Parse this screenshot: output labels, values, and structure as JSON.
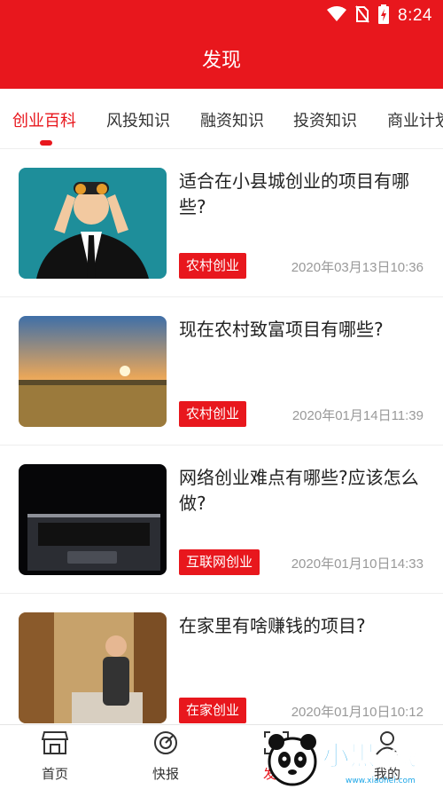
{
  "status": {
    "time": "8:24",
    "icons": [
      "wifi-icon",
      "no-sim-icon",
      "battery-charging-icon"
    ]
  },
  "header": {
    "title": "发现"
  },
  "tabs": [
    {
      "label": "创业百科",
      "active": true
    },
    {
      "label": "风投知识",
      "active": false
    },
    {
      "label": "融资知识",
      "active": false
    },
    {
      "label": "投资知识",
      "active": false
    },
    {
      "label": "商业计划",
      "active": false
    }
  ],
  "articles": [
    {
      "title": "适合在小县城创业的项目有哪些?",
      "tag": "农村创业",
      "date": "2020年03月13日10:36",
      "thumb": "man-with-binoculars"
    },
    {
      "title": "现在农村致富项目有哪些?",
      "tag": "农村创业",
      "date": "2020年01月14日11:39",
      "thumb": "sunset-field"
    },
    {
      "title": "网络创业难点有哪些?应该怎么做?",
      "tag": "互联网创业",
      "date": "2020年01月10日14:33",
      "thumb": "laptop-keyboard"
    },
    {
      "title": "在家里有啥赚钱的项目?",
      "tag": "在家创业",
      "date": "2020年01月10日10:12",
      "thumb": "bookstore-man"
    }
  ],
  "bottom_nav": [
    {
      "label": "首页",
      "icon": "store-icon",
      "active": false
    },
    {
      "label": "快报",
      "icon": "news-radar-icon",
      "active": false
    },
    {
      "label": "发现",
      "icon": "scan-discover-icon",
      "active": true
    },
    {
      "label": "我的",
      "icon": "profile-icon",
      "active": false
    }
  ],
  "watermark": {
    "text": "小黑游戏",
    "url": "www.xiaohei.com"
  },
  "colors": {
    "brand": "#e8171d",
    "text": "#222222",
    "muted": "#999999",
    "divider": "#eeeeee"
  }
}
